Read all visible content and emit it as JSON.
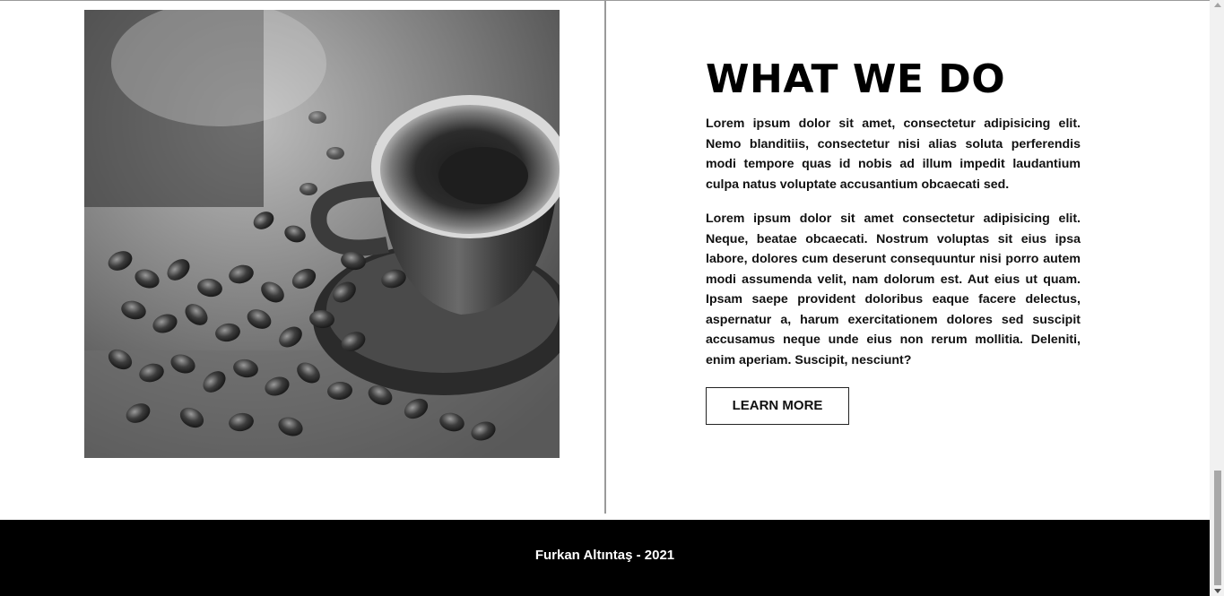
{
  "about": {
    "image": {
      "name": "coffee-cup-photo",
      "description_icon": "coffee-photo"
    },
    "heading": "WHAT WE DO",
    "paragraphs": [
      "Lorem ipsum dolor sit amet, consectetur adipisicing elit. Nemo blanditiis, consectetur nisi alias soluta perferendis modi tempore quas id nobis ad illum impedit laudantium culpa natus voluptate accusantium obcaecati sed.",
      "Lorem ipsum dolor sit amet consectetur adipisicing elit. Neque, beatae obcaecati. Nostrum voluptas sit eius ipsa labore, dolores cum deserunt consequuntur nisi porro autem modi assumenda velit, nam dolorum est. Aut eius ut quam. Ipsam saepe provident doloribus eaque facere delectus, aspernatur a, harum exercitationem dolores sed suscipit accusamus neque unde eius non rerum mollitia. Deleniti, enim aperiam. Suscipit, nesciunt?"
    ],
    "button_label": "LEARN MORE"
  },
  "footer": {
    "text": "Furkan Altıntaş - 2021"
  },
  "colors": {
    "background": "#ffffff",
    "footer_bg": "#000000",
    "footer_text": "#ffffff",
    "text": "#111111",
    "divider": "#9a9a9a"
  }
}
